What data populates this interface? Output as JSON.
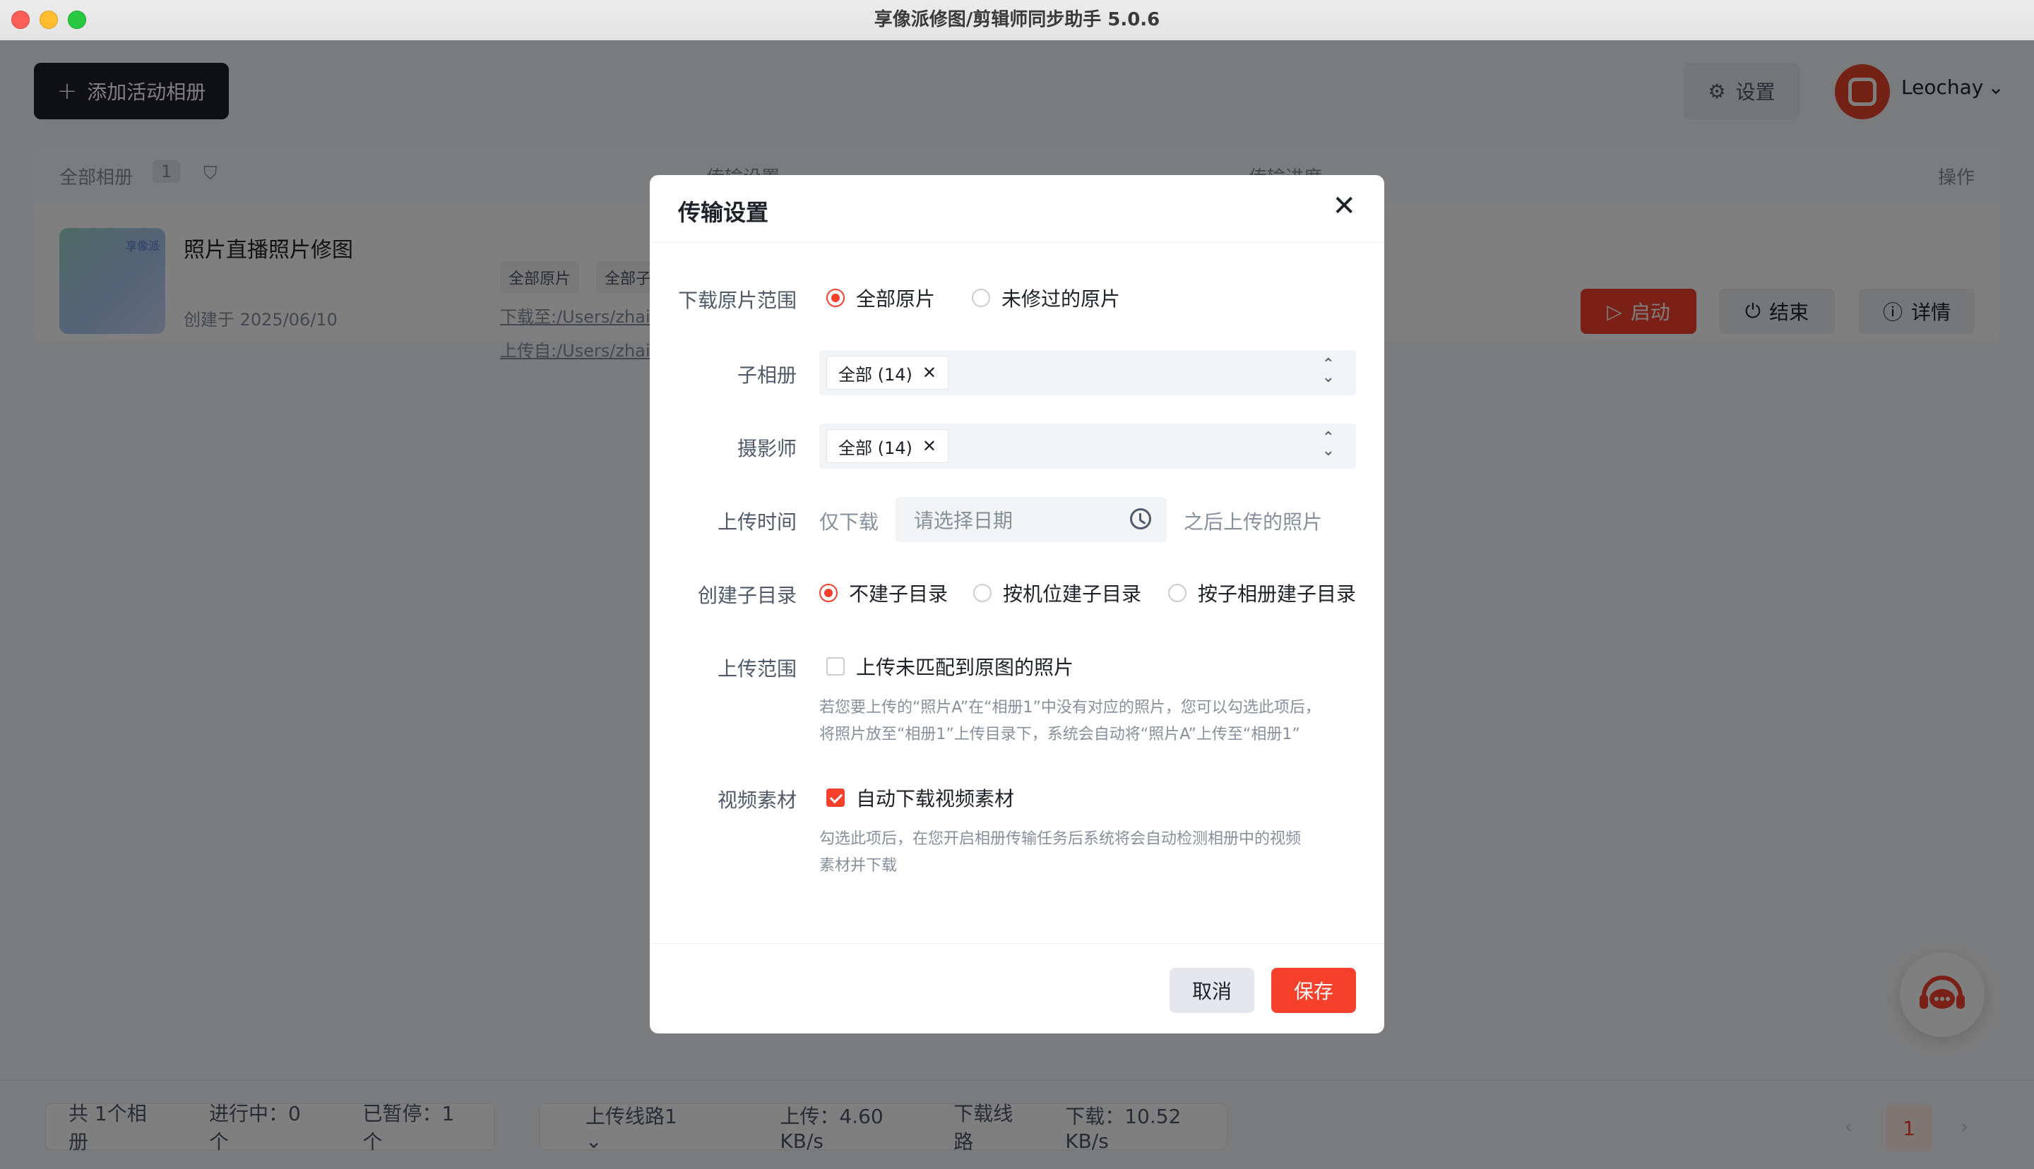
{
  "window": {
    "title": "享像派修图/剪辑师同步助手 5.0.6"
  },
  "toolbar": {
    "add_album_label": "添加活动相册",
    "settings_label": "设置",
    "username": "Leochay"
  },
  "album_table": {
    "headers": {
      "all_albums": "全部相册",
      "count": "1",
      "transfer_settings": "传输设置",
      "transfer_progress": "传输进度",
      "operations": "操作"
    },
    "rows": [
      {
        "thumb_label": "享像派",
        "name": "照片直播照片修图",
        "created": "创建于 2025/06/10",
        "tags": [
          "全部原片",
          "全部子"
        ],
        "download_path": "下载至:/Users/zhai",
        "upload_path": "上传自:/Users/zhai",
        "start_label": "启动",
        "end_label": "结束",
        "detail_label": "详情"
      }
    ]
  },
  "footer": {
    "total": "共 1个相册",
    "running": "进行中：0个",
    "paused": "已暂停：1个",
    "upload_line": "上传线路1",
    "upload_speed": "上传：4.60 KB/s",
    "download_line": "下载线路",
    "download_speed": "下载：10.52 KB/s",
    "page_current": "1"
  },
  "modal": {
    "title": "传输设置",
    "download_range": {
      "label": "下载原片范围",
      "options": [
        "全部原片",
        "未修过的原片"
      ],
      "selected": "全部原片"
    },
    "sub_album": {
      "label": "子相册",
      "tag": "全部 (14)"
    },
    "photographer": {
      "label": "摄影师",
      "tag": "全部 (14)"
    },
    "upload_time": {
      "label": "上传时间",
      "prefix": "仅下载",
      "placeholder": "请选择日期",
      "suffix": "之后上传的照片"
    },
    "subdir": {
      "label": "创建子目录",
      "options": [
        "不建子目录",
        "按机位建子目录",
        "按子相册建子目录"
      ],
      "selected": "不建子目录"
    },
    "upload_range": {
      "label": "上传范围",
      "checkbox_label": "上传未匹配到原图的照片",
      "checked": false,
      "help_line1": "若您要上传的“照片A”在“相册1”中没有对应的照片，您可以勾选此项后，",
      "help_line2": "将照片放至“相册1”上传目录下，系统会自动将“照片A”上传至“相册1”"
    },
    "video": {
      "label": "视频素材",
      "checkbox_label": "自动下载视频素材",
      "checked": true,
      "help_line1": "勾选此项后，在您开启相册传输任务后系统将会自动检测相册中的视频",
      "help_line2": "素材并下载"
    },
    "cancel_label": "取消",
    "save_label": "保存"
  },
  "colors": {
    "accent": "#f5402c",
    "dark_button": "#1d2129"
  }
}
